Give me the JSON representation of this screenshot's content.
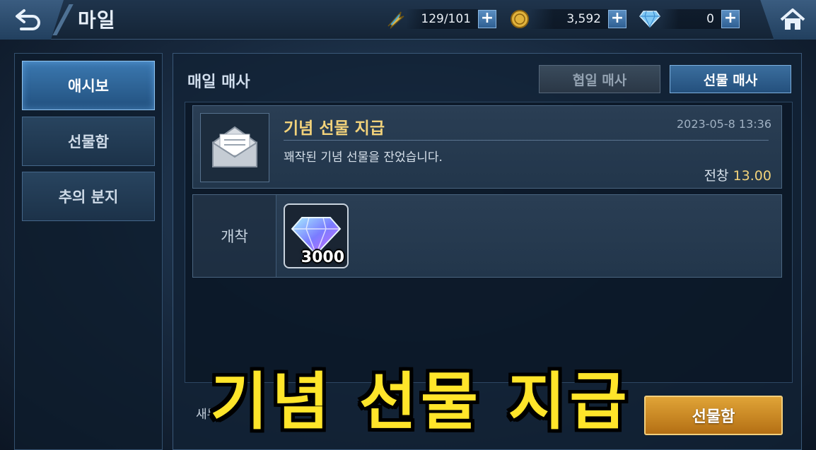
{
  "header": {
    "title": "마일",
    "stamina": {
      "icon": "lightning-feather-icon",
      "value": "129/101"
    },
    "gold": {
      "icon": "gold-coin-icon",
      "value": "3,592"
    },
    "diamond": {
      "icon": "diamond-icon",
      "value": "0"
    },
    "plus_label": "+"
  },
  "sidebar": {
    "items": [
      {
        "label": "애시보",
        "active": true
      },
      {
        "label": "선물함",
        "active": false
      },
      {
        "label": "추의 분지",
        "active": false
      }
    ]
  },
  "main": {
    "section_title": "매일 매사",
    "tabs": [
      {
        "label": "협일 매사",
        "active": false
      },
      {
        "label": "선물 매사",
        "active": true
      }
    ],
    "mail": {
      "title": "기념 선물 지급",
      "date": "2023-05-8 13:36",
      "body": "꽤작된 기념 선물을 잔었습니다.",
      "expire_label": "전창",
      "expire_value": "13.00"
    },
    "reward": {
      "label": "개착",
      "item_icon": "diamond-icon",
      "quantity": "3000"
    },
    "footer_note": "새무",
    "claim_button": "선물함"
  },
  "overlay_caption": "기념 선물 지급",
  "colors": {
    "accent_gold": "#f2d27a",
    "caption_yellow": "#ffe52a",
    "active_blue": "#3b78b0",
    "claim_orange": "#e0a437"
  }
}
